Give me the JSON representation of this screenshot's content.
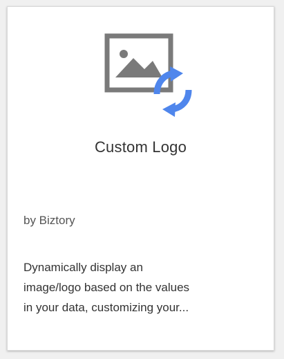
{
  "card": {
    "title": "Custom Logo",
    "author": "by Biztory",
    "description_lines": [
      "Dynamically display an",
      "image/logo based on the values",
      "in your data, customizing your..."
    ],
    "icon": "image-refresh-icon"
  },
  "colors": {
    "icon_gray": "#7a7a7a",
    "icon_blue": "#4f86ec"
  }
}
